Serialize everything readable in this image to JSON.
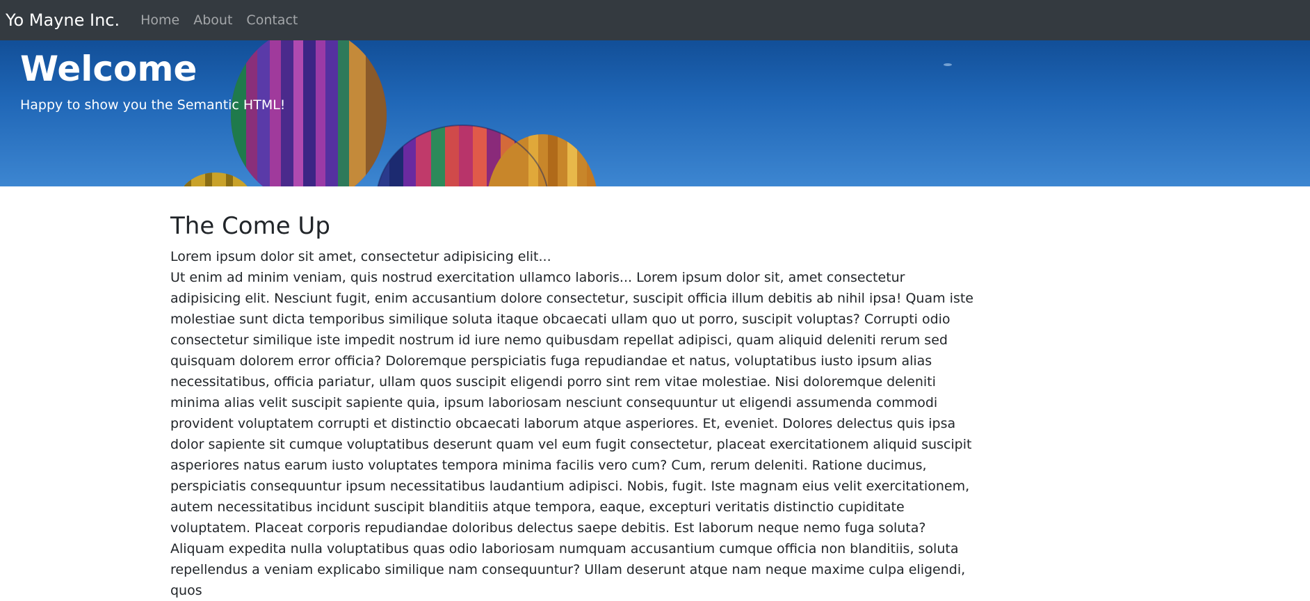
{
  "nav": {
    "brand": "Yo Mayne Inc.",
    "links": [
      "Home",
      "About",
      "Contact"
    ]
  },
  "hero": {
    "title": "Welcome",
    "subtitle": "Happy to show you the Semantic HTML!"
  },
  "main": {
    "section_title": "The Come Up",
    "intro": "Lorem ipsum dolor sit amet, consectetur adipisicing elit...",
    "body": "Ut enim ad minim veniam, quis nostrud exercitation ullamco laboris... Lorem ipsum dolor sit, amet consectetur adipisicing elit. Nesciunt fugit, enim accusantium dolore consectetur, suscipit officia illum debitis ab nihil ipsa! Quam iste molestiae sunt dicta temporibus similique soluta itaque obcaecati ullam quo ut porro, suscipit voluptas? Corrupti odio consectetur similique iste impedit nostrum id iure nemo quibusdam repellat adipisci, quam aliquid deleniti rerum sed quisquam dolorem error officia? Doloremque perspiciatis fuga repudiandae et natus, voluptatibus iusto ipsum alias necessitatibus, officia pariatur, ullam quos suscipit eligendi porro sint rem vitae molestiae. Nisi doloremque deleniti minima alias velit suscipit sapiente quia, ipsum laboriosam nesciunt consequuntur ut eligendi assumenda commodi provident voluptatem corrupti et distinctio obcaecati laborum atque asperiores. Et, eveniet. Dolores delectus quis ipsa dolor sapiente sit cumque voluptatibus deserunt quam vel eum fugit consectetur, placeat exercitationem aliquid suscipit asperiores natus earum iusto voluptates tempora minima facilis vero cum? Cum, rerum deleniti. Ratione ducimus, perspiciatis consequuntur ipsum necessitatibus laudantium adipisci. Nobis, fugit. Iste magnam eius velit exercitationem, autem necessitatibus incidunt suscipit blanditiis atque tempora, eaque, excepturi veritatis distinctio cupiditate voluptatem. Placeat corporis repudiandae doloribus delectus saepe debitis. Est laborum neque nemo fuga soluta? Aliquam expedita nulla voluptatibus quas odio laboriosam numquam accusantium cumque officia non blanditiis, soluta repellendus a veniam explicabo similique nam consequuntur? Ullam deserunt atque nam neque maxime culpa eligendi, quos"
  },
  "colors": {
    "navbar_bg": "#343a40",
    "nav_link": "#8c9096",
    "sky": "#1f66b6",
    "text": "#212529"
  }
}
